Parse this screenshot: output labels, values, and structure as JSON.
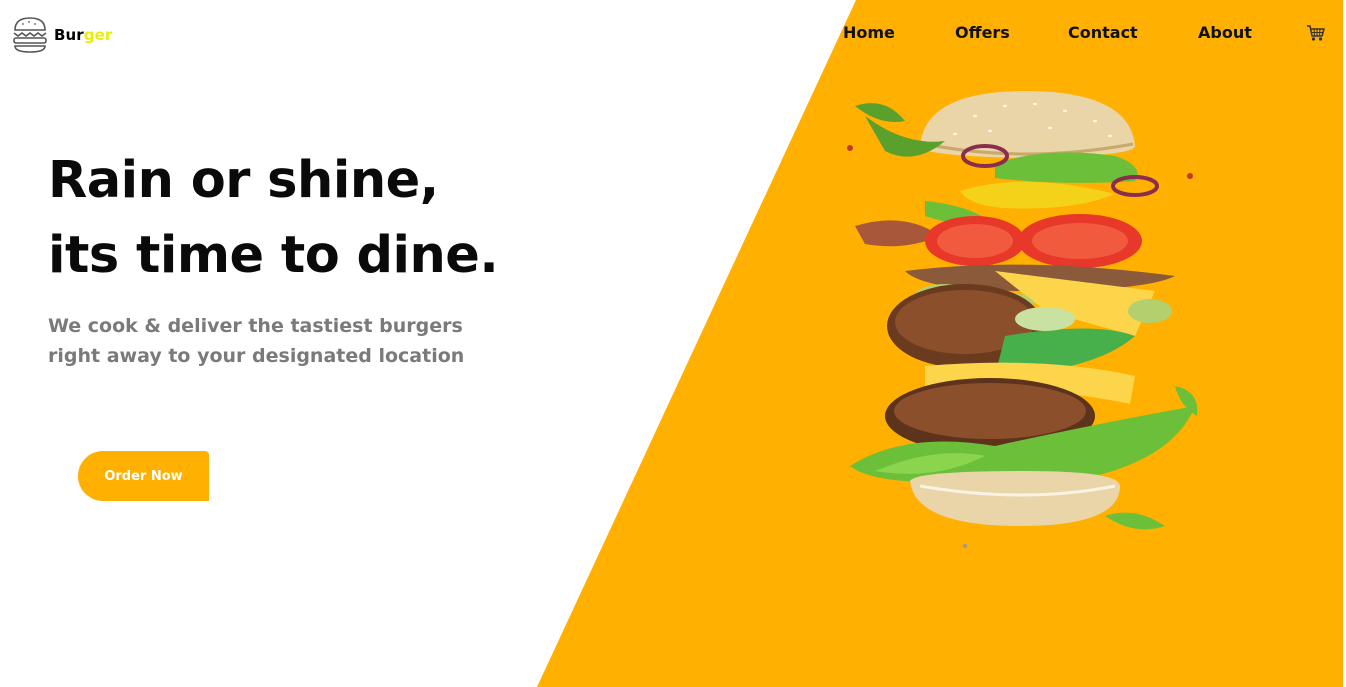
{
  "brand": {
    "name_part1": "Bur",
    "name_part2": "ger",
    "accent_color": "#e8f000",
    "icon": "burger-icon"
  },
  "nav": {
    "items": [
      {
        "label": "Home"
      },
      {
        "label": "Offers"
      },
      {
        "label": "Contact"
      },
      {
        "label": "About"
      }
    ],
    "cart_icon": "cart-icon"
  },
  "hero": {
    "title_line1": "Rain or shine,",
    "title_line2": "its time to dine.",
    "subtitle_line1": "We cook & deliver the tastiest burgers",
    "subtitle_line2": "right away to your designated location",
    "cta_label": "Order Now",
    "image": "burger-illustration"
  },
  "colors": {
    "primary": "#ffb000",
    "text": "#0a0a0a",
    "muted": "#7a7a7a",
    "background": "#ffffff"
  }
}
